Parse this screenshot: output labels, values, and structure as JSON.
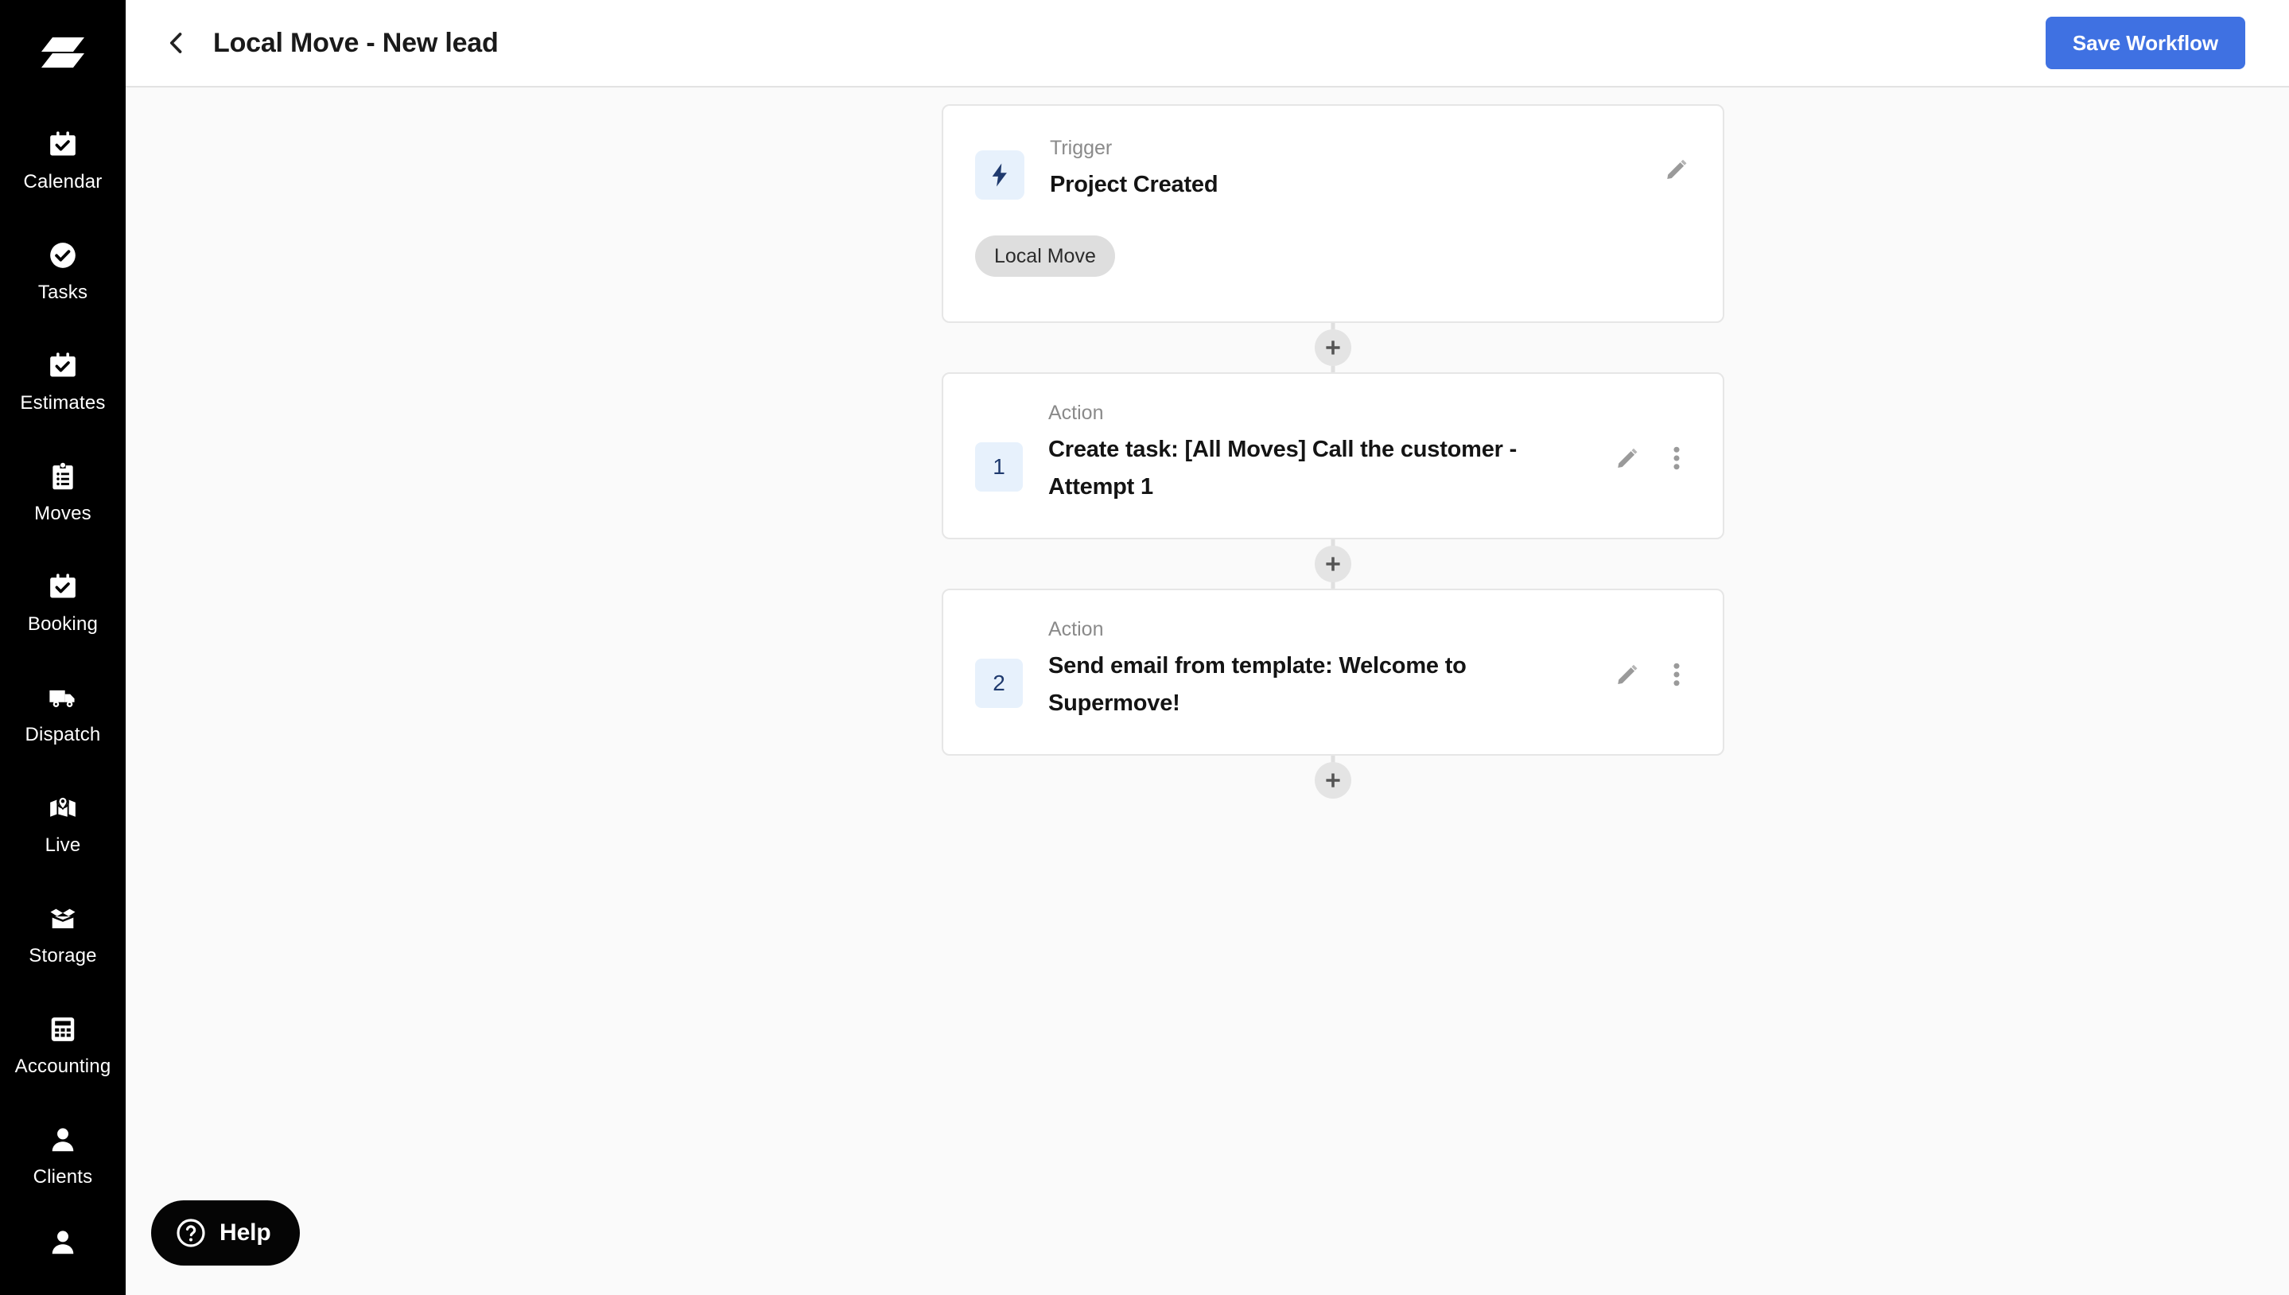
{
  "sidebar": {
    "logo_name": "supermove-logo",
    "items": [
      {
        "label": "Calendar",
        "icon": "calendar-check-icon"
      },
      {
        "label": "Tasks",
        "icon": "check-circle-icon"
      },
      {
        "label": "Estimates",
        "icon": "calendar-check-icon"
      },
      {
        "label": "Moves",
        "icon": "clipboard-list-icon"
      },
      {
        "label": "Booking",
        "icon": "calendar-check-icon"
      },
      {
        "label": "Dispatch",
        "icon": "truck-icon"
      },
      {
        "label": "Live",
        "icon": "map-pin-icon"
      },
      {
        "label": "Storage",
        "icon": "open-box-icon"
      },
      {
        "label": "Accounting",
        "icon": "calculator-icon"
      },
      {
        "label": "Clients",
        "icon": "person-icon"
      },
      {
        "label": "",
        "icon": "person-icon"
      }
    ]
  },
  "topbar": {
    "back_icon": "chevron-left-icon",
    "title": "Local Move - New lead",
    "save_label": "Save Workflow",
    "save_color": "#3f71e2"
  },
  "flow": {
    "trigger": {
      "kicker": "Trigger",
      "headline": "Project Created",
      "icon": "lightning-bolt-icon",
      "icon_bg": "#e7f1fc",
      "icon_color": "#1f3a6e",
      "tag": "Local Move",
      "tag_bg": "#dedede",
      "edit_icon": "pencil-icon"
    },
    "steps": [
      {
        "number": "1",
        "kicker": "Action",
        "headline": "Create task: [All Moves] Call the customer - Attempt 1",
        "edit_icon": "pencil-icon",
        "menu_icon": "more-vertical-icon"
      },
      {
        "number": "2",
        "kicker": "Action",
        "headline": "Send email from template: Welcome to Supermove!",
        "edit_icon": "pencil-icon",
        "menu_icon": "more-vertical-icon"
      }
    ],
    "add_button_icon": "plus-icon"
  },
  "help": {
    "label": "Help",
    "icon": "question-circle-icon"
  }
}
